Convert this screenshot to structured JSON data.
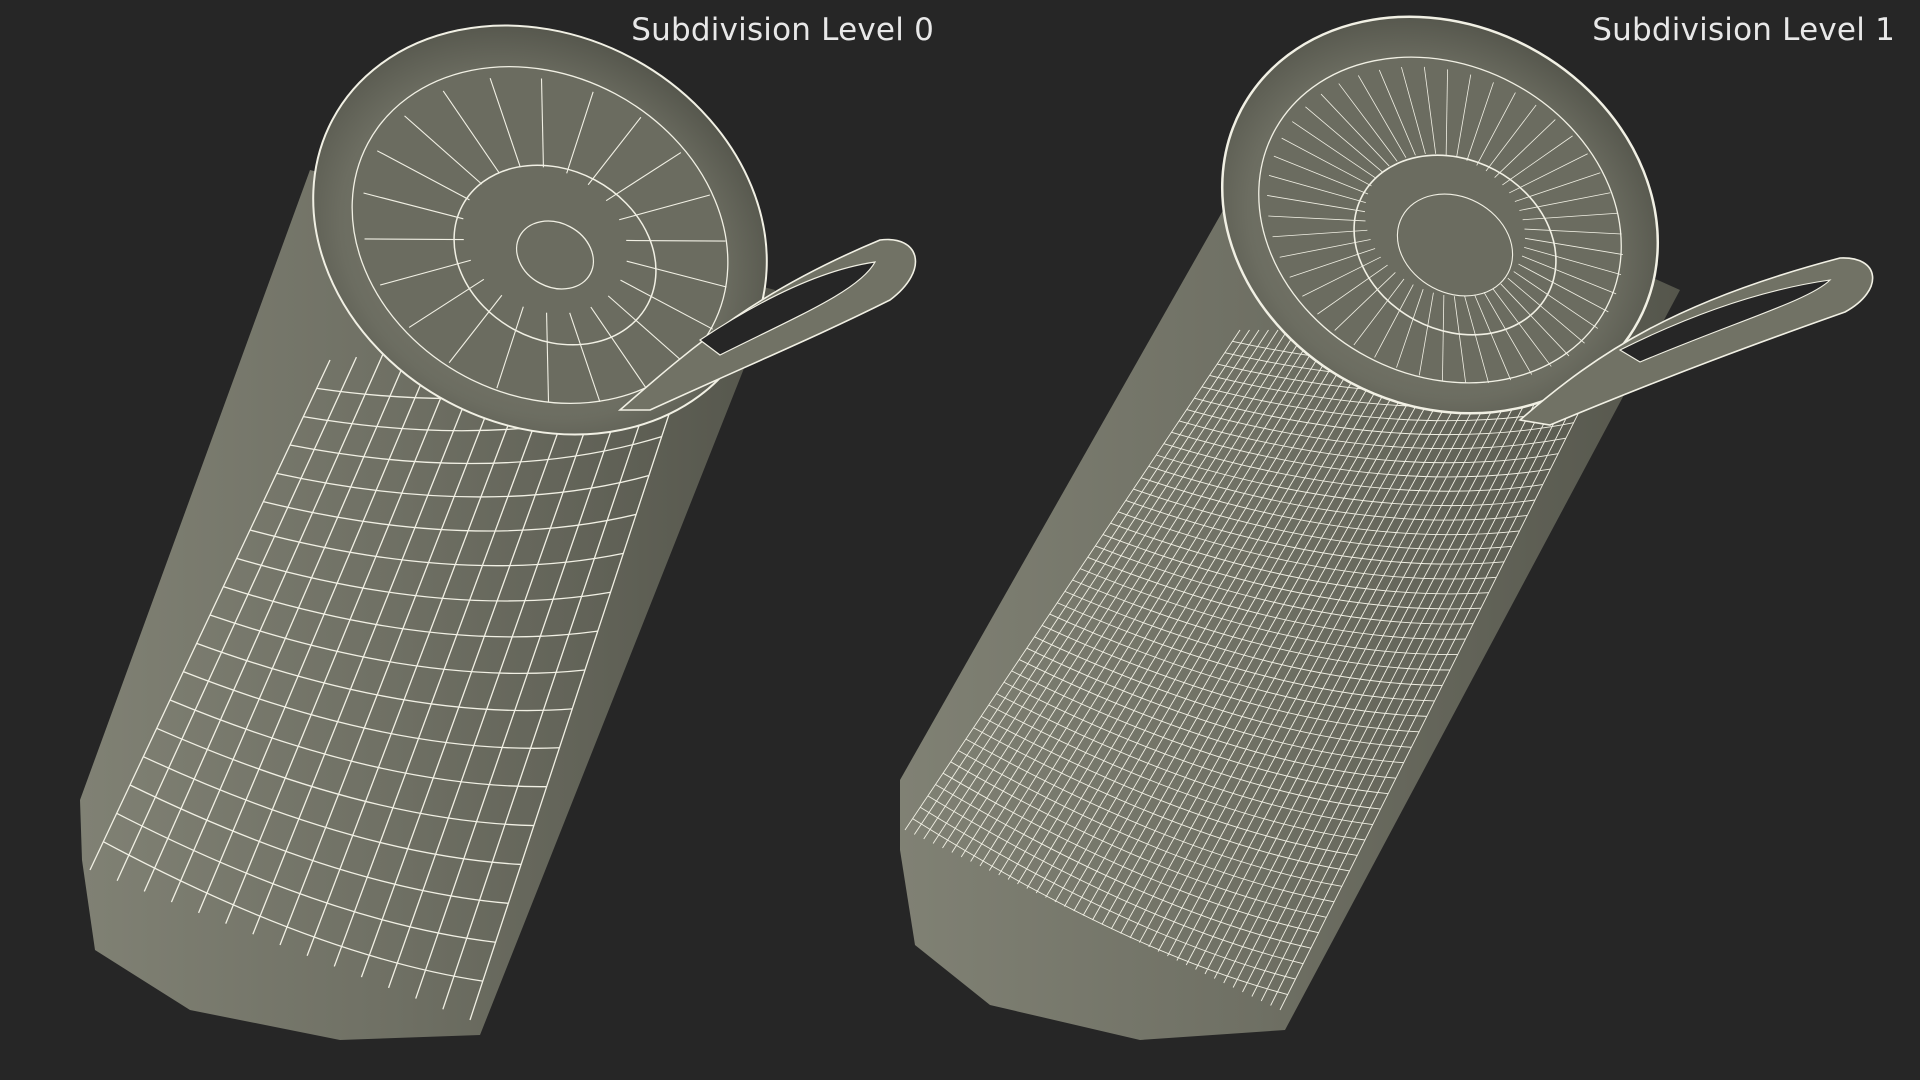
{
  "panels": [
    {
      "label": "Subdivision Level 0",
      "subdivision_level": 0
    },
    {
      "label": "Subdivision Level 1",
      "subdivision_level": 1
    }
  ],
  "colors": {
    "background": "#262626",
    "surface": "#6e6f62",
    "surface_shadow": "#4e4f46",
    "wire": "#f1f0e4",
    "label": "#e8e8e8"
  }
}
